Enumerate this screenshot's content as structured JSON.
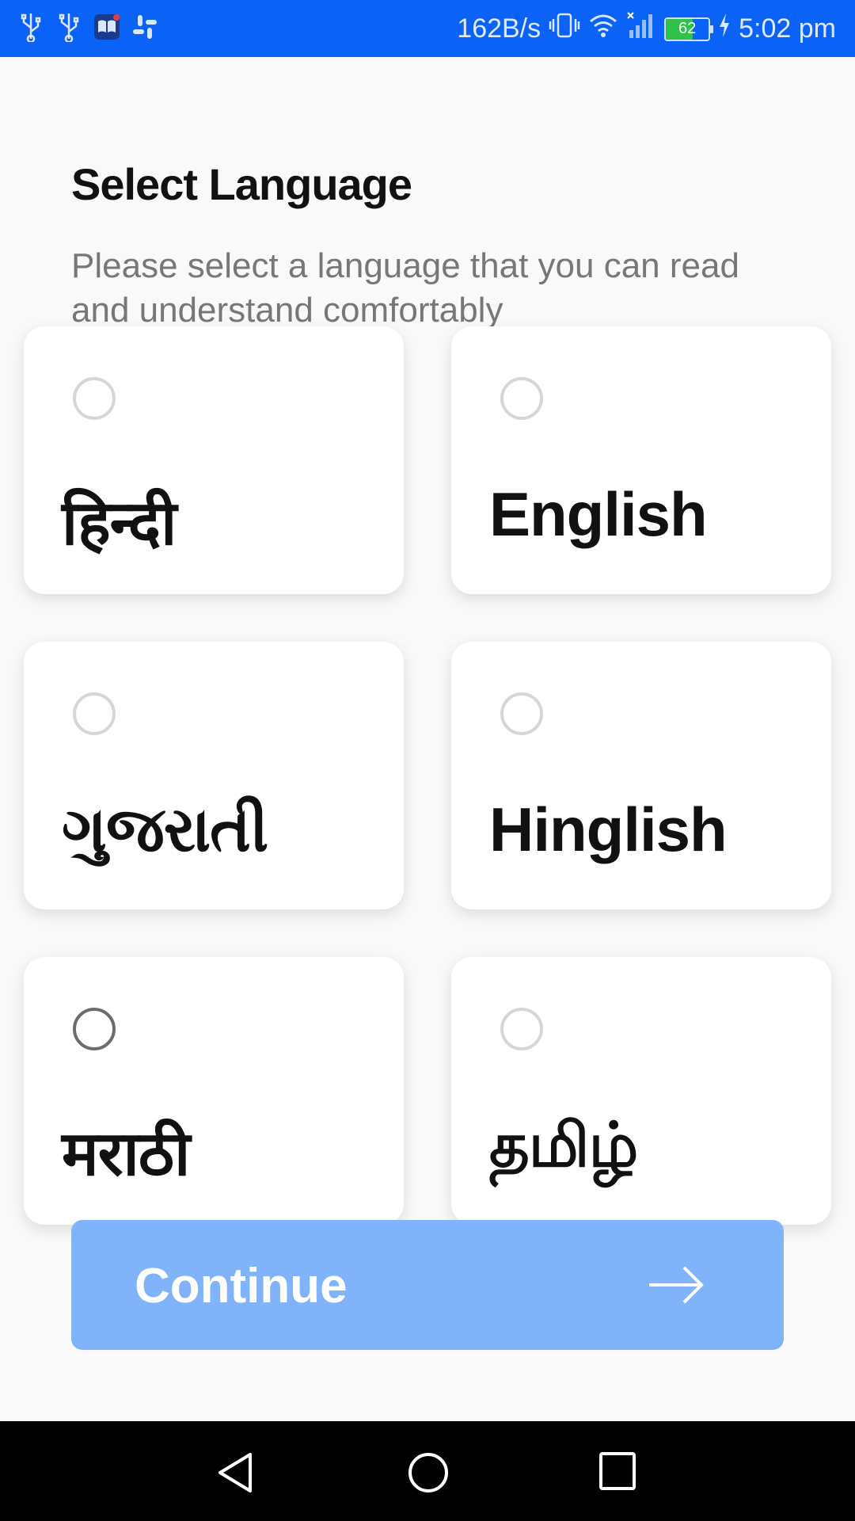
{
  "status_bar": {
    "network_speed": "162B/s",
    "battery_level": "62",
    "time": "5:02 pm",
    "left_icons": [
      "usb-icon",
      "usb-icon",
      "book-app-icon",
      "slack-icon"
    ],
    "right_icons": [
      "vibrate-icon",
      "wifi-icon",
      "signal-icon",
      "battery-icon",
      "charging-icon"
    ]
  },
  "header": {
    "title": "Select Language",
    "subtitle": "Please select a language that you can read and understand comfortably"
  },
  "languages": [
    {
      "label": "हिन्दी"
    },
    {
      "label": "English"
    },
    {
      "label": "ગુજરાતી"
    },
    {
      "label": "Hinglish"
    },
    {
      "label": "मराठी"
    },
    {
      "label": "தமிழ்"
    }
  ],
  "continue_button": {
    "label": "Continue",
    "icon": "arrow-right-icon",
    "color": "#80b3fa"
  },
  "nav_bar": {
    "icons": [
      "back-icon",
      "home-icon",
      "recents-icon"
    ]
  },
  "colors": {
    "status_bar": "#0a63f6",
    "background": "#f9f9f9"
  }
}
